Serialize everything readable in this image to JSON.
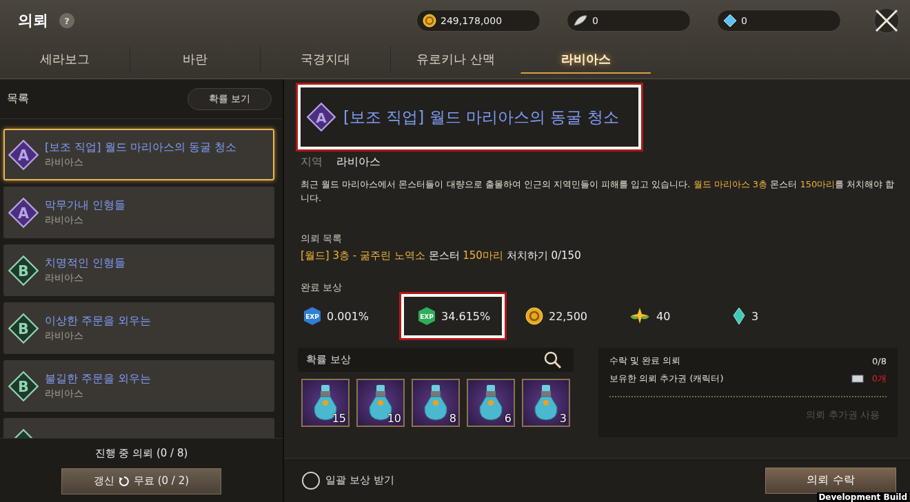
{
  "window": {
    "title": "의뢰",
    "help": "?"
  },
  "currencies": [
    {
      "kind": "gold",
      "value": "249,178,000"
    },
    {
      "kind": "feather",
      "value": "0"
    },
    {
      "kind": "gem",
      "value": "0"
    }
  ],
  "tabs": [
    {
      "label": "세라보그",
      "selected": false
    },
    {
      "label": "바란",
      "selected": false
    },
    {
      "label": "국경지대",
      "selected": false
    },
    {
      "label": "유로키나 산맥",
      "selected": false
    },
    {
      "label": "라비아스",
      "selected": true
    }
  ],
  "sidebar": {
    "title": "목록",
    "odds_button": "확률 보기",
    "items": [
      {
        "grade": "A",
        "title": "[보조 직업] 월드 마리아스의 동굴 청소",
        "region": "라비아스",
        "selected": true
      },
      {
        "grade": "A",
        "title": "막무가내 인형들",
        "region": "라비아스",
        "selected": false
      },
      {
        "grade": "B",
        "title": "치명적인 인형들",
        "region": "라비아스",
        "selected": false
      },
      {
        "grade": "B",
        "title": "이상한 주문을 외우는",
        "region": "라비아스",
        "selected": false
      },
      {
        "grade": "B",
        "title": "불길한 주문을 외우는",
        "region": "라비아스",
        "selected": false
      },
      {
        "selected": false
      }
    ],
    "progress": "진행 중 의뢰 (0 / 8)",
    "refresh_label": "갱신",
    "refresh_cost": "무료 (0 / 2)"
  },
  "detail": {
    "grade": "A",
    "title": "[보조 직업] 월드 마리아스의 동굴 청소",
    "title_highlighted": true,
    "region_label": "지역",
    "region": "라비아스",
    "description": [
      {
        "text": "최근 월드 마리아스에서 몬스터들이 대량으로 출몰하여 인근의 지역민들이 피해를 입고 있습니다. ",
        "highlight": false
      },
      {
        "text": "월드 마리아스 3층",
        "highlight": true
      },
      {
        "text": " 몬스터 ",
        "highlight": false
      },
      {
        "text": "150마리",
        "highlight": true
      },
      {
        "text": "를 처치해야 합니다.",
        "highlight": false
      }
    ],
    "objectives_label": "의뢰 목록",
    "objective": [
      {
        "text": "[월드] 3층 - 굶주린 노역소",
        "highlight": true
      },
      {
        "text": " 몬스터 ",
        "highlight": false
      },
      {
        "text": "150마리",
        "highlight": true
      },
      {
        "text": " 처치하기 0/150",
        "highlight": false
      }
    ],
    "rewards_label": "완료 보상",
    "rewards": [
      {
        "kind": "exp-blue",
        "icon_text": "EXP",
        "value": "0.001%",
        "highlighted": false
      },
      {
        "kind": "exp-green",
        "icon_text": "EXP",
        "value": "34.615%",
        "highlighted": true
      },
      {
        "kind": "gold",
        "value": "22,500",
        "highlighted": false
      },
      {
        "kind": "star",
        "value": "40",
        "highlighted": false
      },
      {
        "kind": "crystal",
        "value": "3",
        "highlighted": false
      }
    ],
    "chance_label": "확률 보상",
    "chance_items": [
      "15",
      "10",
      "8",
      "6",
      "3"
    ],
    "info": [
      {
        "label": "수락 및 완료 의뢰",
        "value": "0/8",
        "kind": "plain"
      },
      {
        "label": "보유한 의뢰 추가권 (캐릭터)",
        "value": "0개",
        "kind": "ticket"
      }
    ],
    "use_ticket": "의뢰 추가권 사용",
    "bulk_label": "일괄 보상 받기",
    "bulk_checked": false,
    "accept": "의뢰 수락"
  },
  "build_label": "Development Build"
}
